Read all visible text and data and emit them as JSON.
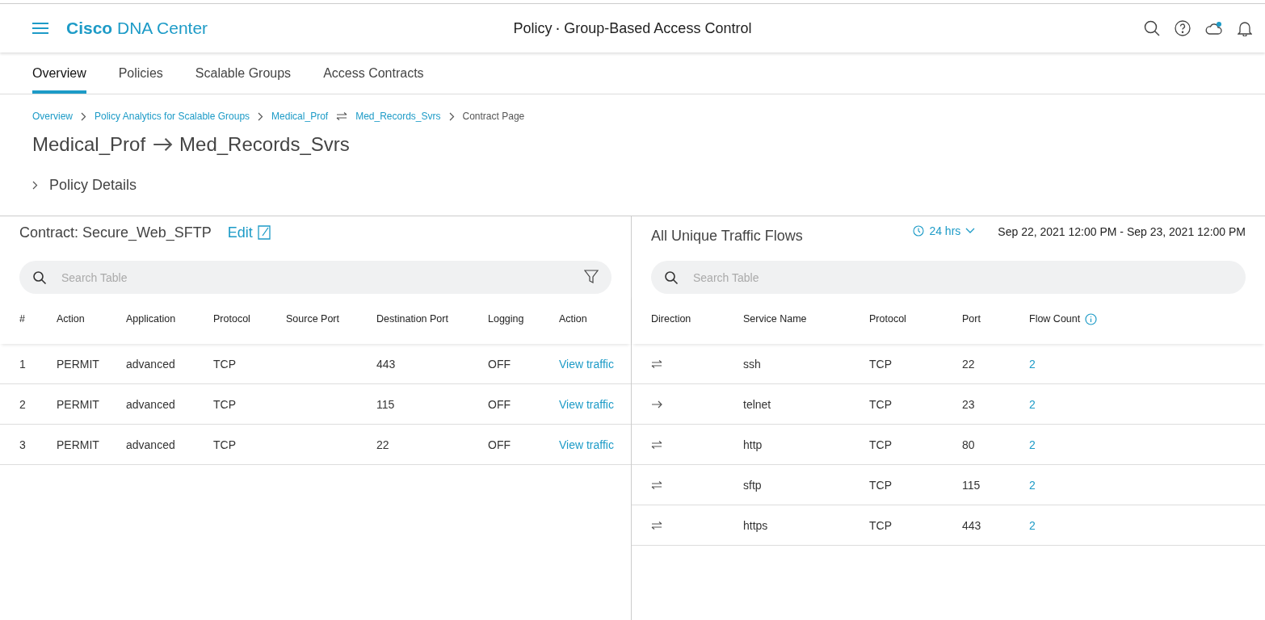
{
  "header": {
    "brand_bold": "Cisco",
    "brand": "DNA Center",
    "title_prefix": "Policy",
    "title_separator": "·",
    "title": "Group-Based Access Control"
  },
  "tabs": [
    {
      "label": "Overview",
      "selected": true
    },
    {
      "label": "Policies",
      "selected": false
    },
    {
      "label": "Scalable Groups",
      "selected": false
    },
    {
      "label": "Access Contracts",
      "selected": false
    }
  ],
  "breadcrumb": [
    {
      "label": "Overview",
      "kind": "link"
    },
    {
      "kind": "chevron"
    },
    {
      "label": "Policy Analytics for Scalable Groups",
      "kind": "link"
    },
    {
      "kind": "chevron"
    },
    {
      "label": "Medical_Prof",
      "kind": "link"
    },
    {
      "kind": "swap"
    },
    {
      "label": "Med_Records_Svrs",
      "kind": "link"
    },
    {
      "kind": "chevron"
    },
    {
      "label": "Contract Page",
      "kind": "current"
    }
  ],
  "page_title": {
    "source": "Medical_Prof",
    "destination": "Med_Records_Svrs"
  },
  "policy_details": {
    "label": "Policy Details",
    "expanded": false
  },
  "contract": {
    "title": "Contract: Secure_Web_SFTP",
    "edit": "Edit",
    "search_placeholder": "Search Table",
    "columns": [
      "#",
      "Action",
      "Application",
      "Protocol",
      "Source Port",
      "Destination Port",
      "Logging",
      "Action"
    ],
    "rows": [
      {
        "index": "1",
        "action": "PERMIT",
        "application": "advanced",
        "protocol": "TCP",
        "destination_port": "443",
        "logging": "OFF",
        "link": "View traffic"
      },
      {
        "index": "2",
        "action": "PERMIT",
        "application": "advanced",
        "protocol": "TCP",
        "destination_port": "115",
        "logging": "OFF",
        "link": "View traffic"
      },
      {
        "index": "3",
        "action": "PERMIT",
        "application": "advanced",
        "protocol": "TCP",
        "destination_port": "22",
        "logging": "OFF",
        "link": "View traffic"
      }
    ]
  },
  "flows": {
    "title": "All Unique Traffic Flows",
    "time_range": "24 hrs",
    "date_range": "Sep 22, 2021 12:00 PM - Sep 23, 2021 12:00 PM",
    "search_placeholder": "Search Table",
    "columns": [
      "Direction",
      "Service Name",
      "Protocol",
      "Port",
      "Flow Count"
    ],
    "rows": [
      {
        "kind": "bidirectional",
        "service": "ssh",
        "protocol": "TCP",
        "port": "22",
        "count": "2"
      },
      {
        "kind": "unidirectional",
        "service": "telnet",
        "protocol": "TCP",
        "port": "23",
        "count": "2"
      },
      {
        "kind": "bidirectional",
        "service": "http",
        "protocol": "TCP",
        "port": "80",
        "count": "2"
      },
      {
        "kind": "bidirectional",
        "service": "sftp",
        "protocol": "TCP",
        "port": "115",
        "count": "2"
      },
      {
        "kind": "bidirectional",
        "service": "https",
        "protocol": "TCP",
        "port": "443",
        "count": "2"
      }
    ]
  }
}
